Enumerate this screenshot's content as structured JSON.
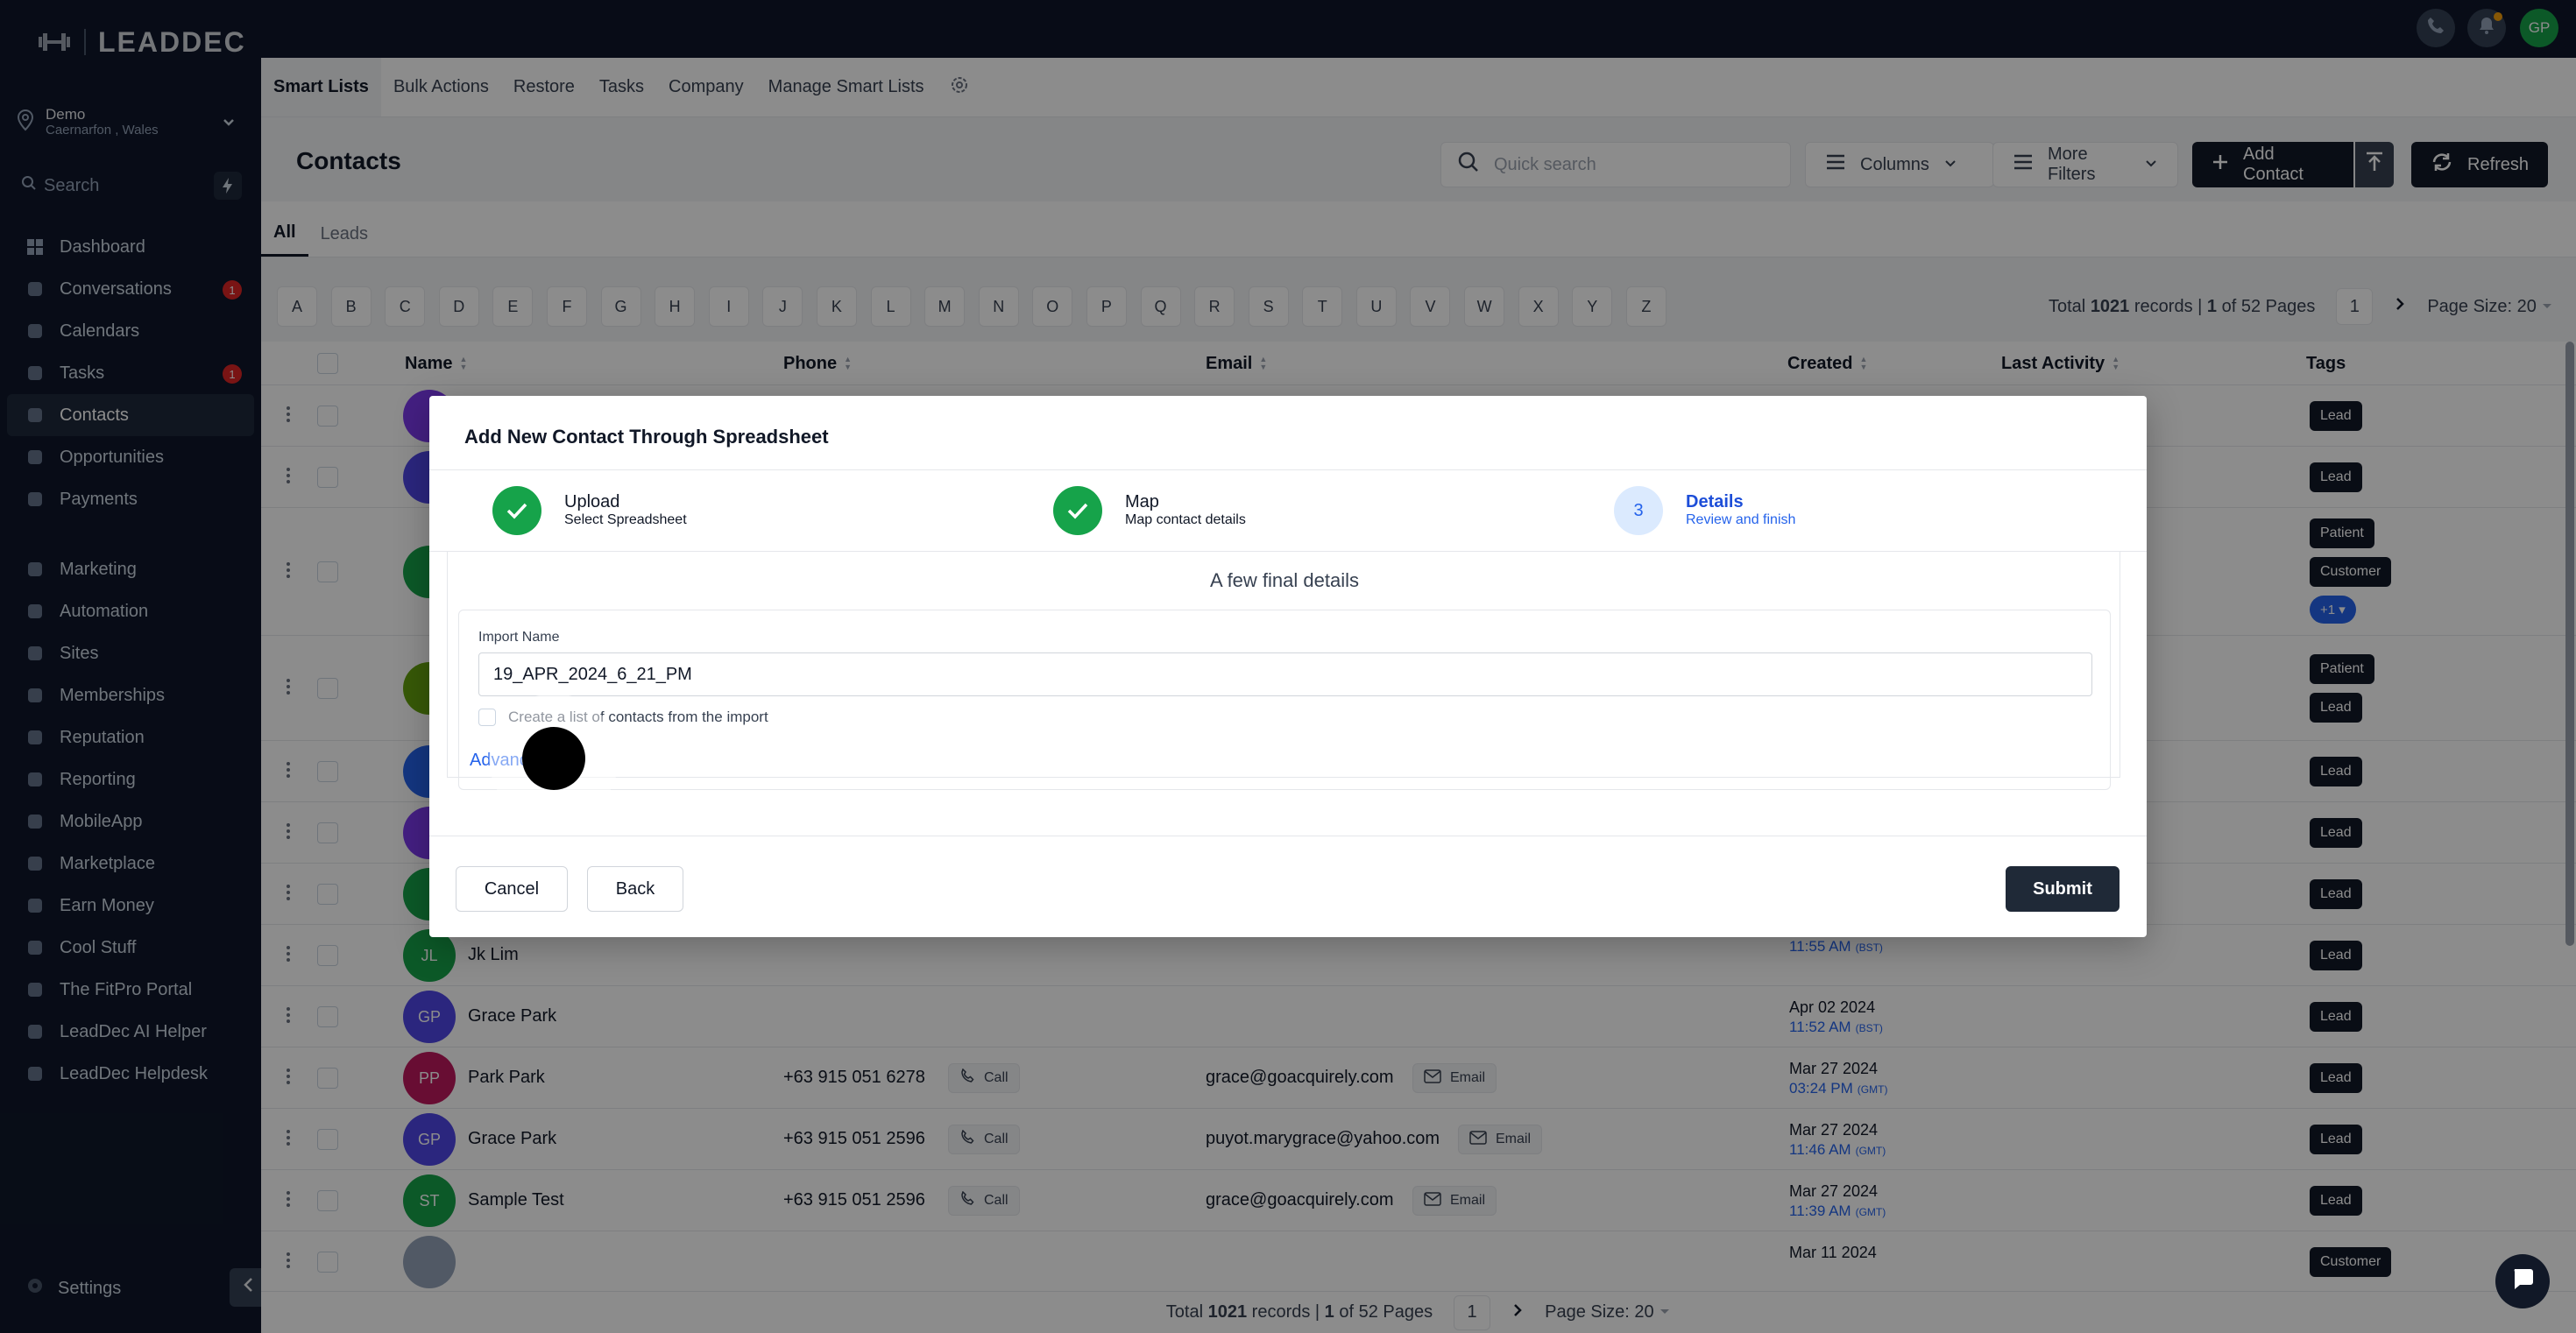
{
  "brand": {
    "name": "LEADDEC"
  },
  "location": {
    "name": "Demo",
    "sub": "Caernarfon , Wales"
  },
  "sidebar": {
    "search_placeholder": "Search",
    "items": [
      {
        "label": "Dashboard",
        "icon": "dashboard-icon"
      },
      {
        "label": "Conversations",
        "icon": "chat-icon",
        "badge": "1"
      },
      {
        "label": "Calendars",
        "icon": "calendar-icon"
      },
      {
        "label": "Tasks",
        "icon": "tasks-icon",
        "badge": "1"
      },
      {
        "label": "Contacts",
        "icon": "contacts-icon",
        "active": true
      },
      {
        "label": "Opportunities",
        "icon": "funnel-icon"
      },
      {
        "label": "Payments",
        "icon": "payments-icon"
      },
      {
        "label": "Marketing",
        "icon": "megaphone-icon"
      },
      {
        "label": "Automation",
        "icon": "automation-icon"
      },
      {
        "label": "Sites",
        "icon": "globe-icon"
      },
      {
        "label": "Memberships",
        "icon": "memberships-icon"
      },
      {
        "label": "Reputation",
        "icon": "star-icon"
      },
      {
        "label": "Reporting",
        "icon": "reporting-icon"
      },
      {
        "label": "MobileApp",
        "icon": "mobile-icon"
      },
      {
        "label": "Marketplace",
        "icon": "cart-icon"
      },
      {
        "label": "Earn Money",
        "icon": "money-icon"
      },
      {
        "label": "Cool Stuff",
        "icon": "flame-icon"
      },
      {
        "label": "The FitPro Portal",
        "icon": "dumbbell-icon"
      },
      {
        "label": "LeadDec AI Helper",
        "icon": "robot-icon"
      },
      {
        "label": "LeadDec Helpdesk",
        "icon": "info-icon"
      }
    ],
    "settings_label": "Settings"
  },
  "topbar": {
    "avatar_initials": "GP"
  },
  "subnav": {
    "tabs": [
      "Smart Lists",
      "Bulk Actions",
      "Restore",
      "Tasks",
      "Company",
      "Manage Smart Lists"
    ]
  },
  "contacts": {
    "title": "Contacts",
    "quick_search_placeholder": "Quick search",
    "columns_label": "Columns",
    "more_filters_label": "More Filters",
    "add_contact_label": "Add Contact",
    "refresh_label": "Refresh",
    "filter_tabs": [
      "All",
      "Leads"
    ],
    "letters": [
      "A",
      "B",
      "C",
      "D",
      "E",
      "F",
      "G",
      "H",
      "I",
      "J",
      "K",
      "L",
      "M",
      "N",
      "O",
      "P",
      "Q",
      "R",
      "S",
      "T",
      "U",
      "V",
      "W",
      "X",
      "Y",
      "Z"
    ],
    "records": {
      "prefix": "Total",
      "total": "1021",
      "mid": "records |",
      "page": "1",
      "of_pages": "of 52 Pages",
      "page_box": "1",
      "page_size": "Page Size: 20"
    },
    "columns": [
      "Name",
      "Phone",
      "Email",
      "Created",
      "Last Activity",
      "Tags"
    ],
    "rows": [
      {
        "initials": "",
        "name": "",
        "phone": "",
        "email": "",
        "date": "",
        "time": "",
        "tz": "",
        "tags": [
          "Lead"
        ]
      },
      {
        "initials": "",
        "name": "",
        "phone": "",
        "email": "",
        "date": "",
        "time": "",
        "tz": "",
        "tags": [
          "Lead"
        ]
      },
      {
        "initials": "",
        "name": "",
        "phone": "",
        "email": "",
        "date": "",
        "time": "",
        "tz": "",
        "tags": [
          "Patient",
          "Customer"
        ],
        "more": "+1"
      },
      {
        "initials": "",
        "name": "",
        "phone": "",
        "email": "",
        "date": "",
        "time": "",
        "tz": "",
        "tags": [
          "Patient",
          "Lead"
        ]
      },
      {
        "initials": "",
        "name": "",
        "phone": "",
        "email": "",
        "date": "",
        "time": "",
        "tz": "",
        "tags": [
          "Lead"
        ]
      },
      {
        "initials": "",
        "name": "",
        "phone": "",
        "email": "",
        "date": "",
        "time": "",
        "tz": "",
        "tags": [
          "Lead"
        ]
      },
      {
        "initials": "",
        "name": "",
        "phone": "",
        "email": "",
        "date": "",
        "time": "",
        "tz": "",
        "tags": [
          "Lead"
        ]
      },
      {
        "initials": "JL",
        "name": "Jk Lim",
        "phone": "",
        "email": "",
        "date": "",
        "time": "11:55 AM",
        "tz": "(BST)",
        "tags": [
          "Lead"
        ]
      },
      {
        "initials": "GP",
        "name": "Grace Park",
        "phone": "",
        "email": "",
        "date": "Apr 02 2024",
        "time": "11:52 AM",
        "tz": "(BST)",
        "tags": [
          "Lead"
        ]
      },
      {
        "initials": "PP",
        "name": "Park Park",
        "phone": "+63 915 051 6278",
        "email": "grace@goacquirely.com",
        "date": "Mar 27 2024",
        "time": "03:24 PM",
        "tz": "(GMT)",
        "tags": [
          "Lead"
        ]
      },
      {
        "initials": "GP",
        "name": "Grace Park",
        "phone": "+63 915 051 2596",
        "email": "puyot.marygrace@yahoo.com",
        "date": "Mar 27 2024",
        "time": "11:46 AM",
        "tz": "(GMT)",
        "tags": [
          "Lead"
        ]
      },
      {
        "initials": "ST",
        "name": "Sample Test",
        "phone": "+63 915 051 2596",
        "email": "grace@goacquirely.com",
        "date": "Mar 27 2024",
        "time": "11:39 AM",
        "tz": "(GMT)",
        "tags": [
          "Lead"
        ]
      },
      {
        "initials": "",
        "name": "",
        "phone": "",
        "email": "",
        "date": "Mar 11 2024",
        "time": "",
        "tz": "",
        "tags": [
          "Customer"
        ]
      }
    ],
    "call_label": "Call",
    "email_label": "Email"
  },
  "modal": {
    "title": "Add New Contact Through Spreadsheet",
    "steps": [
      {
        "name": "Upload",
        "desc": "Select Spreadsheet",
        "state": "done"
      },
      {
        "name": "Map",
        "desc": "Map contact details",
        "state": "done"
      },
      {
        "name": "Details",
        "desc": "Review and finish",
        "state": "current",
        "number": "3"
      }
    ],
    "heading": "A few final details",
    "import_name_label": "Import Name",
    "import_name_value": "19_APR_2024_6_21_PM",
    "create_list_label": "Create a list of contacts from the import",
    "advanced_label": "Advance",
    "cancel_label": "Cancel",
    "back_label": "Back",
    "submit_label": "Submit"
  }
}
